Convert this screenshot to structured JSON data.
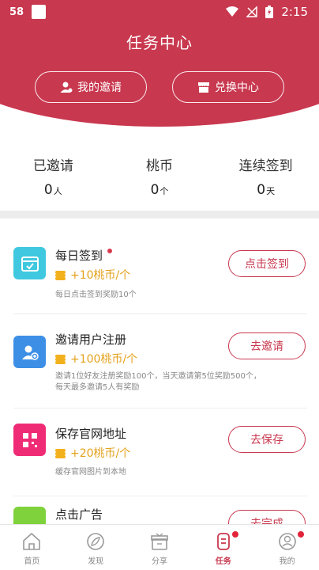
{
  "status_bar": {
    "app_badge": "58",
    "time": "2:15"
  },
  "header": {
    "title": "任务中心",
    "invite_button": "我的邀请",
    "exchange_button": "兑换中心",
    "bg_color": "#c8384f"
  },
  "stats": [
    {
      "label": "已邀请",
      "value": "0",
      "unit": "人"
    },
    {
      "label": "桃币",
      "value": "0",
      "unit": "个"
    },
    {
      "label": "连续签到",
      "value": "0",
      "unit": "天"
    }
  ],
  "tasks": [
    {
      "title": "每日签到",
      "reward": "+10桃币/个",
      "desc": "每日点击签到奖励10个",
      "button": "点击签到",
      "icon": "calendar-check-icon",
      "icon_color": "#3fc8df"
    },
    {
      "title": "邀请用户注册",
      "reward": "+100桃币/个",
      "desc_line1": "邀请1位好友注册奖励100个，当天邀请第5位奖励500个，",
      "desc_line2": "每天最多邀请5人有奖励",
      "button": "去邀请",
      "icon": "add-user-icon",
      "icon_color": "#3d8fe6"
    },
    {
      "title": "保存官网地址",
      "reward": "+20桃币/个",
      "desc": "缓存官网图片到本地",
      "button": "去保存",
      "icon": "qr-code-icon",
      "icon_color": "#f02b76"
    },
    {
      "title": "点击广告",
      "button": "去完成",
      "icon": "ad-icon",
      "icon_color": "#7fd23c"
    }
  ],
  "tabbar": {
    "items": [
      {
        "label": "首页",
        "icon": "home-icon"
      },
      {
        "label": "发现",
        "icon": "compass-icon"
      },
      {
        "label": "分享",
        "icon": "gift-icon"
      },
      {
        "label": "任务",
        "icon": "task-icon",
        "active": true
      },
      {
        "label": "我的",
        "icon": "profile-icon"
      }
    ],
    "active_color": "#c8384f"
  }
}
